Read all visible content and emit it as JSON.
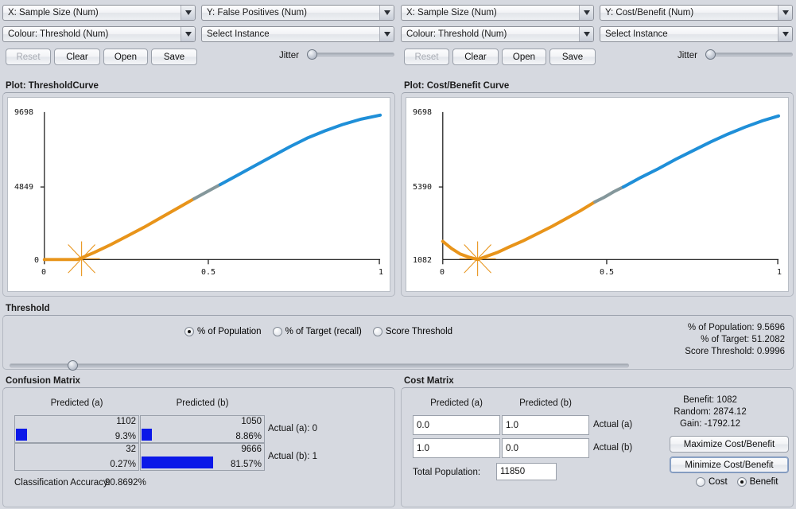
{
  "left_controls": {
    "x_attribute": "X: Sample Size (Num)",
    "y_attribute": "Y: False Positives (Num)",
    "colour_attribute": "Colour: Threshold (Num)",
    "instance_selector": "Select Instance",
    "reset_label": "Reset",
    "clear_label": "Clear",
    "open_label": "Open",
    "save_label": "Save",
    "jitter_label": "Jitter"
  },
  "right_controls": {
    "x_attribute": "X: Sample Size (Num)",
    "y_attribute": "Y: Cost/Benefit (Num)",
    "colour_attribute": "Colour: Threshold (Num)",
    "instance_selector": "Select Instance",
    "reset_label": "Reset",
    "clear_label": "Clear",
    "open_label": "Open",
    "save_label": "Save",
    "jitter_label": "Jitter"
  },
  "left_plot": {
    "title": "Plot: ThresholdCurve"
  },
  "right_plot": {
    "title": "Plot: Cost/Benefit Curve"
  },
  "threshold": {
    "title": "Threshold",
    "options": [
      {
        "label": "% of Population",
        "selected": true
      },
      {
        "label": "% of Target (recall)",
        "selected": false
      },
      {
        "label": "Score Threshold",
        "selected": false
      }
    ],
    "stats": [
      "% of Population: 9.5696",
      "% of Target: 51.2082",
      "Score Threshold: 0.9996"
    ],
    "slider_position_pct": 8.8
  },
  "confusion_matrix": {
    "title": "Confusion Matrix",
    "col_headers": [
      "Predicted (a)",
      "Predicted (b)"
    ],
    "row_labels": [
      "Actual (a): 0",
      "Actual (b): 1"
    ],
    "cells": [
      [
        {
          "count": "1102",
          "percent": "9.3%",
          "bar_pct": 9.3
        },
        {
          "count": "1050",
          "percent": "8.86%",
          "bar_pct": 8.86
        }
      ],
      [
        {
          "count": "32",
          "percent": "0.27%",
          "bar_pct": 0.27
        },
        {
          "count": "9666",
          "percent": "81.57%",
          "bar_pct": 81.57
        }
      ]
    ],
    "accuracy_label": "Classification Accuracy:",
    "accuracy_value": "90.8692%"
  },
  "cost_matrix": {
    "title": "Cost Matrix",
    "col_headers": [
      "Predicted (a)",
      "Predicted (b)"
    ],
    "row_labels": [
      "Actual (a)",
      "Actual (b)"
    ],
    "values": [
      [
        "0.0",
        "1.0"
      ],
      [
        "1.0",
        "0.0"
      ]
    ],
    "total_population_label": "Total Population:",
    "total_population_value": "11850",
    "benefit_line": "Benefit: 1082",
    "random_line": "Random: 2874.12",
    "gain_line": "Gain: -1792.12",
    "maximize_label": "Maximize Cost/Benefit",
    "minimize_label": "Minimize Cost/Benefit",
    "mode_options": [
      {
        "label": "Cost",
        "selected": false
      },
      {
        "label": "Benefit",
        "selected": true
      }
    ]
  },
  "chart_data": [
    {
      "type": "scatter",
      "title": "Plot: ThresholdCurve",
      "xlabel": "Sample Size",
      "ylabel": "False Positives",
      "xlim": [
        0,
        1
      ],
      "ylim": [
        0,
        9698
      ],
      "xticks": [
        "0",
        "0.5",
        "1"
      ],
      "yticks": [
        "0",
        "4849",
        "9698"
      ],
      "grid": false,
      "colour_by": "Threshold",
      "marker_point": {
        "x": 0.096,
        "y": 0
      },
      "series": [
        {
          "name": "ThresholdCurve",
          "x": [
            0.0,
            0.05,
            0.096,
            0.15,
            0.2,
            0.25,
            0.3,
            0.35,
            0.4,
            0.45,
            0.5,
            0.55,
            0.6,
            0.65,
            0.7,
            0.75,
            0.8,
            0.85,
            0.9,
            0.95,
            1.0
          ],
          "y": [
            0,
            0,
            0,
            420,
            900,
            1400,
            1960,
            2520,
            3080,
            3660,
            4240,
            4820,
            5410,
            6000,
            6600,
            7180,
            7760,
            8320,
            8860,
            9330,
            9698
          ]
        }
      ]
    },
    {
      "type": "scatter",
      "title": "Plot: Cost/Benefit Curve",
      "xlabel": "Sample Size",
      "ylabel": "Cost/Benefit",
      "xlim": [
        0,
        1
      ],
      "ylim": [
        1082,
        9698
      ],
      "xticks": [
        "0",
        "0.5",
        "1"
      ],
      "yticks": [
        "1082",
        "5390",
        "9698"
      ],
      "grid": false,
      "colour_by": "Threshold",
      "marker_point": {
        "x": 0.096,
        "y": 1082
      },
      "series": [
        {
          "name": "Cost/Benefit Curve",
          "x": [
            0.0,
            0.03,
            0.06,
            0.096,
            0.13,
            0.18,
            0.24,
            0.3,
            0.36,
            0.42,
            0.48,
            0.54,
            0.6,
            0.66,
            0.72,
            0.78,
            0.84,
            0.9,
            0.95,
            1.0
          ],
          "y": [
            1880,
            1640,
            1330,
            1082,
            1230,
            1480,
            1820,
            2230,
            2700,
            3180,
            3680,
            4200,
            4740,
            5300,
            5880,
            6480,
            7080,
            7720,
            8260,
            8820
          ]
        }
      ]
    }
  ],
  "colors": {
    "curve_low": "#e8941a",
    "curve_mid": "#6f8f95",
    "curve_high": "#1f8fd8",
    "bar_blue": "#0b18e8",
    "panel_bg": "#d6d9e0"
  }
}
